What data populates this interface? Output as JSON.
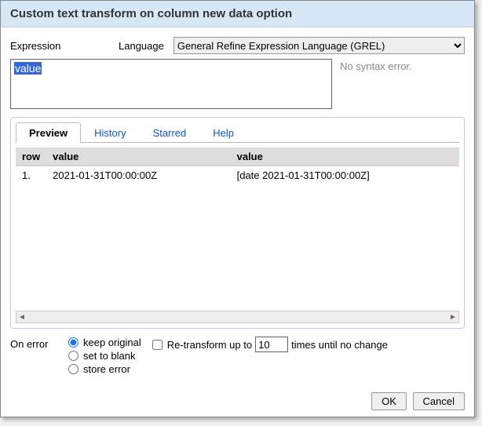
{
  "dialog": {
    "title": "Custom text transform on column new data option",
    "expression_label": "Expression",
    "language_label": "Language",
    "language_value": "General Refine Expression Language (GREL)",
    "expression_value": "value",
    "syntax_message": "No syntax error."
  },
  "tabs": {
    "preview": "Preview",
    "history": "History",
    "starred": "Starred",
    "help": "Help"
  },
  "preview": {
    "headers": {
      "row": "row",
      "value1": "value",
      "value2": "value"
    },
    "rows": [
      {
        "idx": "1.",
        "val1": "2021-01-31T00:00:00Z",
        "val2": "[date 2021-01-31T00:00:00Z]"
      }
    ]
  },
  "onerror": {
    "label": "On error",
    "keep_original": "keep original",
    "set_to_blank": "set to blank",
    "store_error": "store error",
    "retransform_prefix": "Re-transform up to",
    "retransform_count": "10",
    "retransform_suffix": "times until no change"
  },
  "buttons": {
    "ok": "OK",
    "cancel": "Cancel"
  }
}
